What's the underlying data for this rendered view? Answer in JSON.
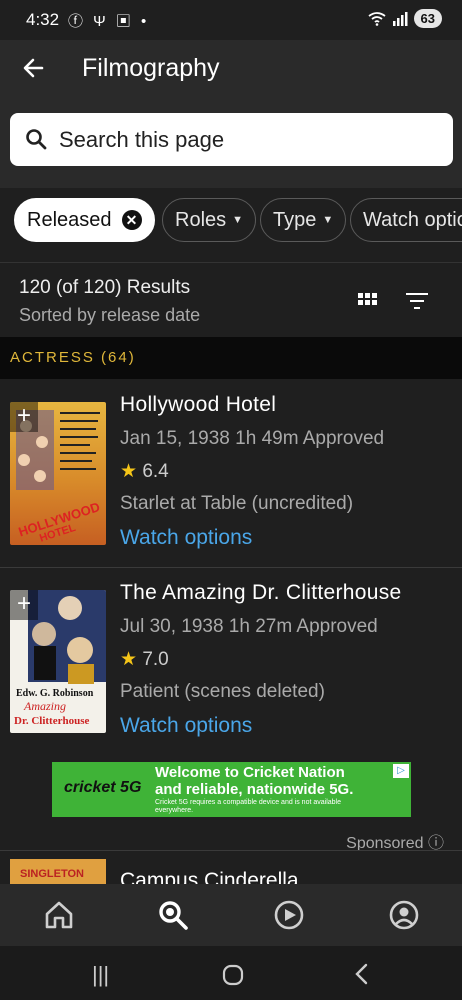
{
  "status": {
    "time": "4:32",
    "left_icons": "ⓕ Ψ ▣ •",
    "battery": "63"
  },
  "header": {
    "title": "Filmography"
  },
  "search": {
    "placeholder": "Search this page"
  },
  "chips": [
    {
      "label": "Released"
    },
    {
      "label": "Roles"
    },
    {
      "label": "Type"
    },
    {
      "label": "Watch options"
    }
  ],
  "results": {
    "count": "120 (of 120) Results",
    "sort": "Sorted by release date"
  },
  "section": {
    "label": "ACTRESS (64)"
  },
  "items": [
    {
      "title": "Hollywood Hotel",
      "meta": "Jan 15, 1938  1h 49m  Approved",
      "rating": "6.4",
      "role": "Starlet at Table (uncredited)",
      "watch": "Watch options",
      "poster_text": "HOLLYWOOD HOTEL"
    },
    {
      "title": "The Amazing Dr. Clitterhouse",
      "meta": "Jul 30, 1938  1h 27m  Approved",
      "rating": "7.0",
      "role": "Patient (scenes deleted)",
      "watch": "Watch options",
      "poster_text": "Edw. G. Robinson Amazing Dr. Clitterhouse"
    }
  ],
  "ad": {
    "brand": "cricket 5G",
    "headline1": "Welcome to Cricket Nation",
    "headline2": "and reliable, nationwide 5G.",
    "fine": "Cricket 5G requires a compatible device and is not available everywhere.",
    "sponsored": "Sponsored"
  },
  "peek": {
    "title": "Campus Cinderella",
    "poster_text": "SINGLETON DAVIS"
  },
  "colors": {
    "accent": "#f5c518",
    "link": "#4aa6e8",
    "section": "#e0b73a",
    "ad_bg": "#3fb337"
  }
}
